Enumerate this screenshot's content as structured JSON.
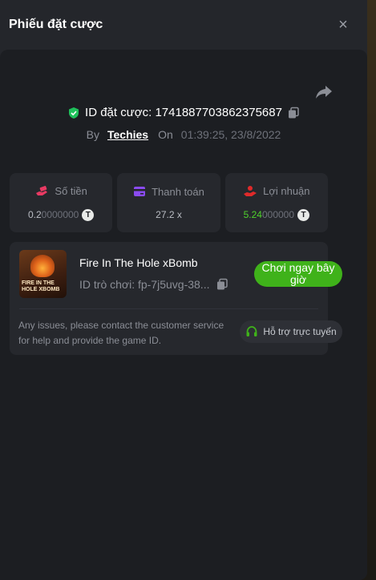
{
  "modal": {
    "title": "Phiếu đặt cược",
    "close_label": "×"
  },
  "bet": {
    "id_label": "ID đặt cược: 1741887703862375687",
    "by_label": "By",
    "user": "Techies",
    "on_label": "On",
    "time": "01:39:25, 23/8/2022"
  },
  "stats": [
    {
      "label": "Số tiền",
      "value_main": "0.2",
      "value_dim": "0000000",
      "icon": "money-hand-icon",
      "coin": "T"
    },
    {
      "label": "Thanh toán",
      "value_main": "27.2 x",
      "value_dim": "",
      "icon": "card-icon"
    },
    {
      "label": "Lợi nhuận",
      "value_main": "5.24",
      "value_dim": "000000",
      "icon": "profit-hand-icon",
      "coin": "T"
    }
  ],
  "game": {
    "title": "Fire In The Hole xBomb",
    "id_text": "ID trò chơi: fp-7j5uvg-38...",
    "thumb_text": "FIRE IN THE HOLE XBOMB",
    "play_label": "Chơi ngay bây giờ",
    "help_text": "Any issues, please contact the customer service for help and provide the game ID.",
    "support_label": "Hỗ trợ trực tuyến"
  },
  "colors": {
    "accent_green": "#3fb21a",
    "profit_green": "#4fd22c",
    "verified_green": "#1ec05a",
    "money_icon": "#e83a63",
    "card_icon": "#8a4bf0",
    "profit_icon": "#e02a2a"
  }
}
